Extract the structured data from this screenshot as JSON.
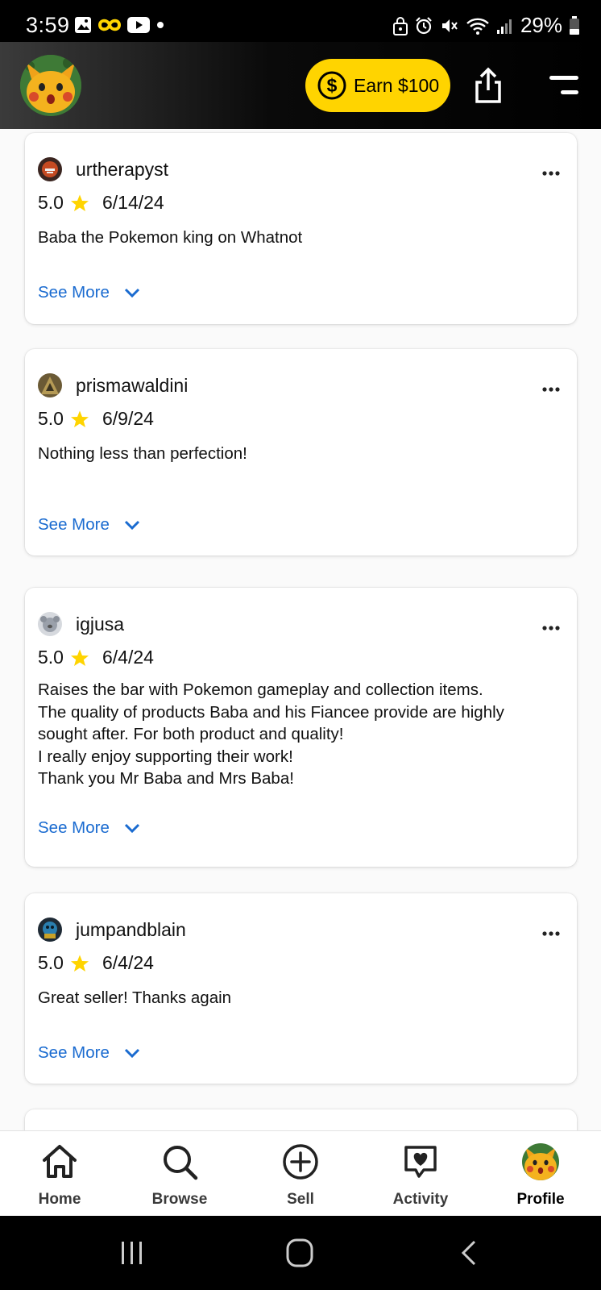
{
  "status_bar": {
    "time": "3:59",
    "battery": "29%",
    "left_icons": [
      "gallery-icon",
      "infinity-icon",
      "youtube-icon",
      "dot-icon"
    ],
    "right_icons": [
      "lock-icon",
      "alarm-icon",
      "mute-icon",
      "wifi-icon",
      "signal-icon",
      "battery-icon"
    ]
  },
  "header": {
    "earn_label": "Earn $100",
    "accent_color": "#ffd400"
  },
  "reviews": [
    {
      "username": "urtherapyst",
      "rating": "5.0",
      "date": "6/14/24",
      "text": "Baba the Pokemon king on Whatnot",
      "see_more": "See More"
    },
    {
      "username": "prismawaldini",
      "rating": "5.0",
      "date": "6/9/24",
      "text": "Nothing less than perfection!",
      "see_more": "See More"
    },
    {
      "username": "igjusa",
      "rating": "5.0",
      "date": "6/4/24",
      "text": "Raises the bar with Pokemon gameplay and collection items.\nThe quality of products Baba and his Fiancee provide are highly sought after. For both product and quality!\nI really enjoy supporting their work!\nThank you Mr Baba and Mrs Baba!",
      "see_more": "See More"
    },
    {
      "username": "jumpandblain",
      "rating": "5.0",
      "date": "6/4/24",
      "text": "Great seller! Thanks again",
      "see_more": "See More"
    }
  ],
  "bottom_nav": {
    "items": [
      {
        "label": "Home",
        "icon": "home-icon"
      },
      {
        "label": "Browse",
        "icon": "search-icon"
      },
      {
        "label": "Sell",
        "icon": "plus-circle-icon"
      },
      {
        "label": "Activity",
        "icon": "heart-chat-icon"
      },
      {
        "label": "Profile",
        "icon": "avatar-icon",
        "active": true
      }
    ]
  },
  "colors": {
    "link": "#1a6bd0",
    "star": "#ffd400"
  }
}
